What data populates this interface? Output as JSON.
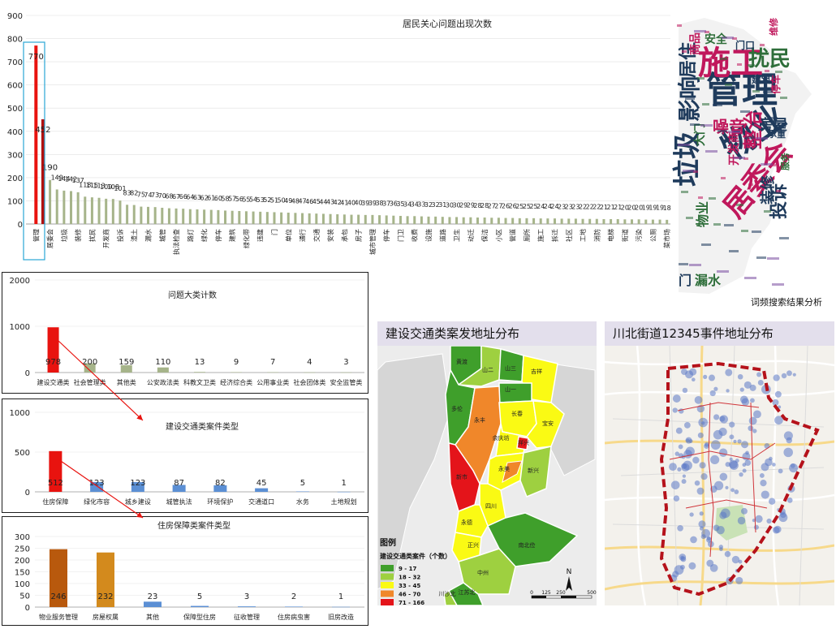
{
  "colors": {
    "top_bar": "#e8130f",
    "grey_bar": "#a6b48a",
    "blue_bar": "#5b8fd4",
    "brown_bar": "#b8590d",
    "orange_bar": "#d38a1d",
    "highlight": "#2aa7d6",
    "map_header": "#e3dfec"
  },
  "chart_data": [
    {
      "type": "bar",
      "title": "居民关心问题出现次数",
      "ylim": [
        0,
        900
      ],
      "yticks": [
        "0",
        "100",
        "200",
        "300",
        "400",
        "500",
        "600",
        "700",
        "800",
        "900"
      ],
      "categories": [
        "管理",
        "",
        "居委会",
        "",
        "垃圾",
        "",
        "装修",
        "",
        "扰民",
        "",
        "开发商",
        "",
        "投诉",
        "",
        "渣土",
        "",
        "漏水",
        "",
        "城管",
        "",
        "执法检查",
        "",
        "路灯",
        "",
        "绿化",
        "",
        "停车",
        "",
        "建筑",
        "",
        "绿化带",
        "",
        "违建",
        "",
        "门",
        "",
        "单位",
        "",
        "通行",
        "",
        "交通",
        "",
        "安装",
        "",
        "承包",
        "",
        "房子",
        "",
        "城市管理",
        "",
        "停车",
        "",
        "门卫",
        "",
        "收费",
        "",
        "设施",
        "",
        "道路",
        "",
        "卫生",
        "",
        "动迁",
        "",
        "保洁",
        "",
        "小区",
        "",
        "管道",
        "",
        "厕所",
        "",
        "施工",
        "",
        "拆迁",
        "",
        "社区",
        "",
        "工地",
        "",
        "消防",
        "",
        "电梯",
        "",
        "街道",
        "",
        "污染",
        "",
        "公厕",
        "",
        "菜市场",
        "",
        "垃圾桶",
        "",
        "安装"
      ],
      "values": [
        770,
        452,
        190,
        149,
        144,
        142,
        137,
        118,
        115,
        113,
        109,
        108,
        101,
        83,
        82,
        75,
        74,
        73,
        70,
        68,
        67,
        66,
        64,
        63,
        62,
        61,
        60,
        58,
        57,
        56,
        55,
        54,
        53,
        52,
        51,
        50,
        49,
        48,
        47,
        46,
        45,
        44,
        43,
        42,
        41,
        40,
        40,
        39,
        39,
        38,
        37,
        36,
        35,
        34,
        34,
        33,
        32,
        32,
        31,
        30,
        30,
        29,
        29,
        28,
        28,
        27,
        27,
        26,
        26,
        25,
        25,
        25,
        24,
        24,
        24,
        23,
        23,
        23,
        22,
        22,
        22,
        21,
        21,
        21,
        20,
        20,
        20,
        19,
        19,
        19,
        18
      ],
      "value_labels": [
        "770",
        "452",
        "190",
        "149",
        "144",
        "142",
        "137",
        "118",
        "115",
        "113",
        "109",
        "108",
        "101",
        "83",
        "82",
        "75",
        "74",
        "73",
        "70",
        "68",
        "67",
        "66",
        "64",
        "63",
        "62",
        "61",
        "60",
        "58",
        "57",
        "56",
        "55",
        "54",
        "53",
        "52",
        "51",
        "50",
        "49",
        "48",
        "47",
        "46",
        "45",
        "44",
        "43",
        "42",
        "41",
        "40",
        "40",
        "39",
        "39",
        "38",
        "37",
        "36",
        "35",
        "34",
        "34",
        "33",
        "32",
        "32",
        "31",
        "30",
        "30",
        "29",
        "29",
        "28",
        "28",
        "27",
        "27",
        "26",
        "26",
        "25",
        "25",
        "25",
        "24",
        "24",
        "24",
        "23",
        "23",
        "23",
        "22",
        "22",
        "22",
        "21",
        "21",
        "21",
        "20",
        "20",
        "20",
        "19",
        "19",
        "19",
        "18"
      ]
    },
    {
      "type": "bar",
      "title": "问题大类计数",
      "ylim": [
        0,
        2000
      ],
      "yticks": [
        "0",
        "1000",
        "2000"
      ],
      "categories": [
        "建设交通类",
        "社会管理类",
        "其他类",
        "公安政法类",
        "科教文卫类",
        "经济综合类",
        "公用事业类",
        "社会团体类",
        "安全监管类"
      ],
      "values": [
        978,
        200,
        159,
        110,
        13,
        9,
        7,
        4,
        3
      ],
      "value_labels": [
        "978",
        "200",
        "159",
        "110",
        "13",
        "9",
        "7",
        "4",
        "3"
      ]
    },
    {
      "type": "bar",
      "title": "建设交通类案件类型",
      "ylim": [
        0,
        1000
      ],
      "yticks": [
        "0",
        "500",
        "1000"
      ],
      "categories": [
        "住房保障",
        "绿化市容",
        "城乡建设",
        "城管执法",
        "环境保护",
        "交通道口",
        "水务",
        "土地规划"
      ],
      "values": [
        512,
        123,
        123,
        87,
        82,
        45,
        5,
        1
      ],
      "value_labels": [
        "512",
        "123",
        "123",
        "87",
        "82",
        "45",
        "5",
        "1"
      ]
    },
    {
      "type": "bar",
      "title": "住房保障类案件类型",
      "ylim": [
        0,
        300
      ],
      "yticks": [
        "0",
        "50",
        "100",
        "150",
        "200",
        "250",
        "300"
      ],
      "categories": [
        "物业服务管理",
        "房屋权属",
        "其他",
        "保障型住房",
        "征收管理",
        "住房病虫害",
        "旧房改造"
      ],
      "values": [
        246,
        232,
        23,
        5,
        3,
        2,
        1
      ],
      "value_labels": [
        "246",
        "232",
        "23",
        "5",
        "3",
        "2",
        "1"
      ]
    }
  ],
  "wordcloud": {
    "caption": "词频搜索结果分析",
    "words": [
      {
        "text": "管理",
        "color": "#1f3b5c"
      },
      {
        "text": "物业",
        "color": "#1f3b5c"
      },
      {
        "text": "施工",
        "color": "#c0185c"
      },
      {
        "text": "垃圾",
        "color": "#1f3b5c"
      },
      {
        "text": "居委会",
        "color": "#c0185c"
      },
      {
        "text": "影响",
        "color": "#1f3b5c"
      },
      {
        "text": "扰民",
        "color": "#2e6e3a"
      },
      {
        "text": "居住",
        "color": "#1f3b5c"
      },
      {
        "text": "噪音",
        "color": "#c0185c"
      },
      {
        "text": "房屋",
        "color": "#1f3b5c"
      },
      {
        "text": "整治",
        "color": "#c0185c"
      },
      {
        "text": "装修",
        "color": "#1f3b5c"
      },
      {
        "text": "投诉",
        "color": "#1f3b5c"
      },
      {
        "text": "安全",
        "color": "#2e6e3a"
      },
      {
        "text": "建筑",
        "color": "#1f3b5c"
      },
      {
        "text": "漏水",
        "color": "#2e6e3a"
      },
      {
        "text": "门",
        "color": "#1f3b5c"
      },
      {
        "text": "开发商",
        "color": "#c0185c"
      },
      {
        "text": "大门",
        "color": "#2e6e3a"
      },
      {
        "text": "门口",
        "color": "#1f3b5c"
      },
      {
        "text": "维修",
        "color": "#c0185c"
      },
      {
        "text": "停车",
        "color": "#c0185c"
      },
      {
        "text": "物业",
        "color": "#2e6e3a"
      },
      {
        "text": "商品",
        "color": "#c0185c"
      },
      {
        "text": "服务",
        "color": "#2e6e3a"
      },
      {
        "text": "承重",
        "color": "#1f3b5c"
      }
    ]
  },
  "map1": {
    "title": "建设交通类案发地址分布",
    "legend_title": "图例",
    "legend_subtitle": "建设交通类案件（个数）",
    "legend_items": [
      {
        "label": "9 - 17",
        "color": "#3f9f2b"
      },
      {
        "label": "18 - 32",
        "color": "#9ed040"
      },
      {
        "label": "33 - 45",
        "color": "#fafa14"
      },
      {
        "label": "46 - 70",
        "color": "#f0872a"
      },
      {
        "label": "71 - 166",
        "color": "#e4141a"
      }
    ],
    "north": "N",
    "scale": [
      "0",
      "125",
      "250",
      "500"
    ],
    "labels": [
      "黄渡",
      "山二",
      "山三",
      "吉祥",
      "山一",
      "多伦",
      "永丰",
      "长春",
      "宝安",
      "余庆坊",
      "祥兴",
      "永美",
      "新兴",
      "新市",
      "四川",
      "永德",
      "正兴",
      "南北俭",
      "中州",
      "江苏北",
      "川沙北"
    ]
  },
  "map2": {
    "title": "川北街道12345事件地址分布"
  }
}
